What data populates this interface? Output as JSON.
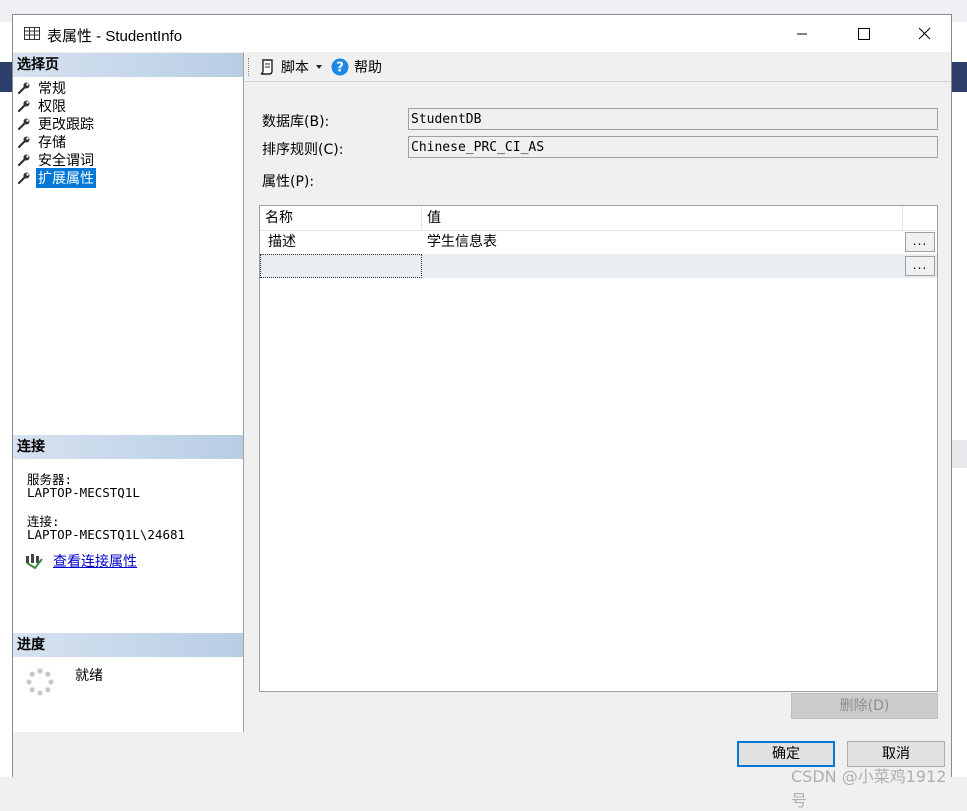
{
  "dialog": {
    "title": "表属性 - StudentInfo"
  },
  "left_pane": {
    "select_header": "选择页",
    "pages": [
      {
        "label": "常规"
      },
      {
        "label": "权限"
      },
      {
        "label": "更改跟踪"
      },
      {
        "label": "存储"
      },
      {
        "label": "安全谓词"
      },
      {
        "label": "扩展属性"
      }
    ],
    "connect_header": "连接",
    "server_label": "服务器:",
    "server_value": "LAPTOP-MECSTQ1L",
    "connection_label": "连接:",
    "connection_value": "LAPTOP-MECSTQ1L\\24681",
    "view_connection_link": "查看连接属性",
    "progress_header": "进度",
    "progress_status": "就绪"
  },
  "toolbar": {
    "script_label": "脚本",
    "help_label": "帮助"
  },
  "form": {
    "database_label": "数据库(B):",
    "database_value": "StudentDB",
    "collation_label": "排序规则(C):",
    "collation_value": "Chinese_PRC_CI_AS",
    "properties_label": "属性(P):"
  },
  "grid": {
    "columns": [
      "名称",
      "值"
    ],
    "rows": [
      {
        "name": "描述",
        "value": "学生信息表"
      },
      {
        "name": "",
        "value": ""
      }
    ],
    "ellipsis_label": "..."
  },
  "buttons": {
    "delete_label": "删除(D)",
    "ok_label": "确定",
    "cancel_label": "取消"
  },
  "watermark": "CSDN @小菜鸡1912号",
  "colors": {
    "selection": "#0078d7",
    "link": "#0000cc",
    "header_gradient_start": "#d6e2f0",
    "header_gradient_end": "#b8cde4"
  }
}
